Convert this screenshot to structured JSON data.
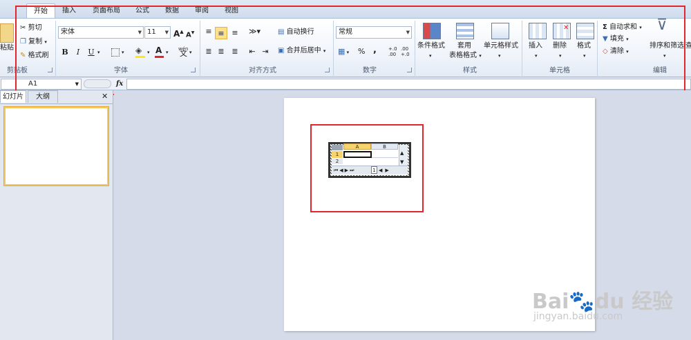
{
  "tabs": [
    "开始",
    "插入",
    "页面布局",
    "公式",
    "数据",
    "审阅",
    "视图"
  ],
  "clipboard": {
    "paste_label": "粘贴",
    "cut": "剪切",
    "copy": "复制",
    "format_painter": "格式刷",
    "group": "剪贴板"
  },
  "font": {
    "name": "宋体",
    "size": "11",
    "group": "字体",
    "bold": "B",
    "italic": "I",
    "underline": "U",
    "grow": "A",
    "shrink": "A",
    "font_color_glyph": "A",
    "phonetic": "wén"
  },
  "alignment": {
    "wrap": "自动换行",
    "merge": "合并后居中",
    "group": "对齐方式"
  },
  "number": {
    "format": "常规",
    "percent": "%",
    "comma": ",",
    "inc": "+.0 .00",
    "dec": ".00 +.0",
    "group": "数字"
  },
  "styles": {
    "conditional": "条件格式",
    "table_line1": "套用",
    "table_line2": "表格格式",
    "cell_styles": "单元格样式",
    "group": "样式"
  },
  "cells": {
    "insert": "插入",
    "delete": "删除",
    "format": "格式",
    "group": "单元格"
  },
  "editing": {
    "autosum": "自动求和",
    "fill": "填充",
    "clear": "清除",
    "sort": "排序和筛选",
    "find_partial": "查",
    "group": "编辑"
  },
  "formula_bar": {
    "name_box": "A1",
    "fx": "fx"
  },
  "side_tabs": [
    "幻灯片",
    "大纲"
  ],
  "close_glyph": "✕",
  "embedded_sheet": {
    "col_a": "A",
    "col_b": "B",
    "row1": "1",
    "row2": "2",
    "sheet_tab": "1"
  },
  "watermark": {
    "brand": "Bai",
    "brand_paw": "du",
    "brand_cn": "经验",
    "url": "jingyan.baidu.com"
  },
  "colors": {
    "highlight": "#e0262a",
    "accent_yellow": "#fde08a"
  }
}
